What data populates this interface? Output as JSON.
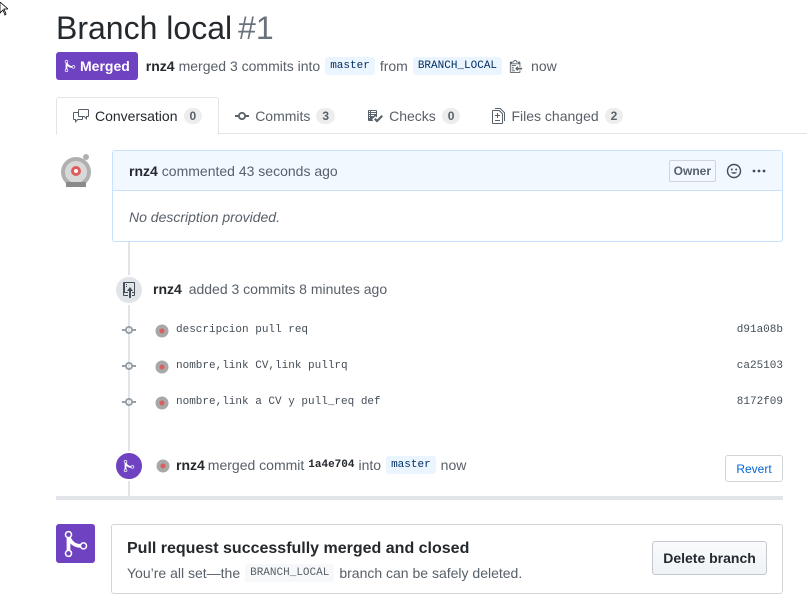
{
  "pr": {
    "title": "Branch local",
    "number": "#1",
    "state_label": "Merged",
    "author": "rnz4",
    "merge_text": "merged 3 commits into",
    "base_branch": "master",
    "from_text": "from",
    "head_branch": "BRANCH_LOCAL",
    "time": "now"
  },
  "tabs": [
    {
      "label": "Conversation",
      "count": "0"
    },
    {
      "label": "Commits",
      "count": "3"
    },
    {
      "label": "Checks",
      "count": "0"
    },
    {
      "label": "Files changed",
      "count": "2"
    }
  ],
  "comment": {
    "author": "rnz4",
    "action": "commented 43 seconds ago",
    "badge": "Owner",
    "body": "No description provided."
  },
  "push_event": {
    "author": "rnz4",
    "text": "added 3 commits 8 minutes ago"
  },
  "commits": [
    {
      "message": "descripcion pull req",
      "sha": "d91a08b"
    },
    {
      "message": "nombre,link CV,link pullrq",
      "sha": "ca25103"
    },
    {
      "message": "nombre,link a CV y pull_req def",
      "sha": "8172f09"
    }
  ],
  "merge_event": {
    "author": "rnz4",
    "text": "merged commit",
    "sha": "1a4e704",
    "into": "into",
    "branch": "master",
    "time": "now",
    "revert_label": "Revert"
  },
  "merge_box": {
    "title": "Pull request successfully merged and closed",
    "desc_before": "You’re all set—the",
    "branch": "BRANCH_LOCAL",
    "desc_after": "branch can be safely deleted.",
    "delete_label": "Delete branch"
  },
  "colors": {
    "merged": "#6f42c1",
    "link": "#0366d6"
  }
}
